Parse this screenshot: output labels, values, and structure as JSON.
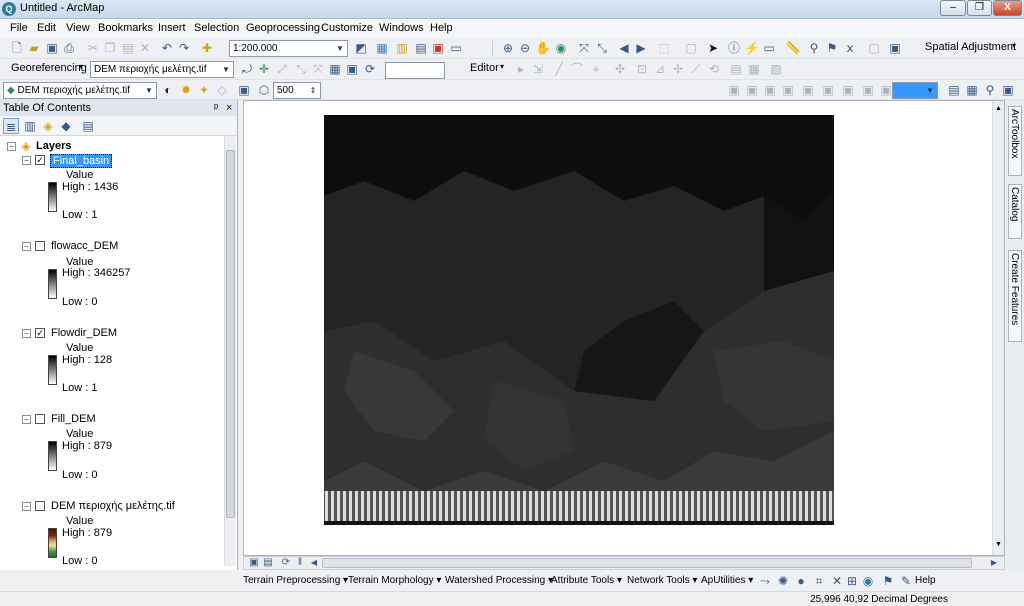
{
  "window": {
    "title": "Untitled - ArcMap",
    "app_icon": "Q",
    "minimize": "–",
    "restore": "❐",
    "close": "X"
  },
  "menubar": {
    "items": [
      "File",
      "Edit",
      "View",
      "Bookmarks",
      "Insert",
      "Selection",
      "Geoprocessing",
      "Customize",
      "Windows",
      "Help"
    ]
  },
  "standard_toolbar": {
    "scale": "1:200.000",
    "spatial_adjustment": "Spatial Adjustment"
  },
  "georef_toolbar": {
    "label": "Georeferencing",
    "layer": "DEM περιοχής μελέτης.tif",
    "editor": "Editor"
  },
  "third_toolbar": {
    "layer": "DEM περιοχής μελέτης.tif",
    "value": "500"
  },
  "toc": {
    "title": "Table Of Contents",
    "pin": "ᵖ",
    "close": "×",
    "root": "Layers",
    "layers": [
      {
        "name": "Final_basin",
        "checked": true,
        "value_label": "Value",
        "high": "High : 1436",
        "low": "Low : 1",
        "ramp": "gray"
      },
      {
        "name": "flowacc_DEM",
        "checked": false,
        "value_label": "Value",
        "high": "High : 346257",
        "low": "Low : 0",
        "ramp": "gray"
      },
      {
        "name": "Flowdir_DEM",
        "checked": true,
        "value_label": "Value",
        "high": "High : 128",
        "low": "Low : 1",
        "ramp": "gray"
      },
      {
        "name": "Fill_DEM",
        "checked": false,
        "value_label": "Value",
        "high": "High : 879",
        "low": "Low : 0",
        "ramp": "gray"
      },
      {
        "name": "DEM περιοχής μελέτης.tif",
        "checked": false,
        "value_label": "Value",
        "high": "High : 879",
        "low": "Low : 0",
        "ramp": "color"
      }
    ]
  },
  "side_tabs": [
    "ArcToolbox",
    "Catalog",
    "Create Features"
  ],
  "bottom_toolbar": {
    "items": [
      "Terrain Preprocessing ▾",
      "Terrain Morphology ▾",
      "Watershed Processing ▾",
      "Attribute Tools ▾",
      "Network Tools ▾",
      "ApUtilities ▾"
    ],
    "help": "Help"
  },
  "status": {
    "coords": "25,996  40,92 Decimal Degrees"
  },
  "colors": {
    "map_dark": "#1a1a1a",
    "map_mid": "#3a3a3a",
    "selected_layer": "#3399ff"
  }
}
